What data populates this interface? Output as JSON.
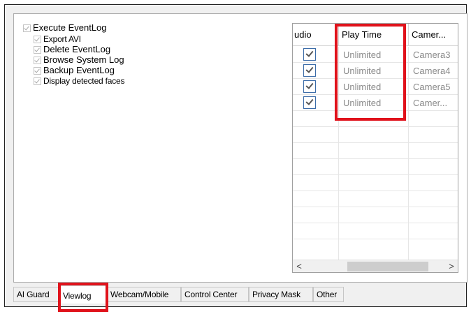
{
  "permissions": [
    {
      "label": "Execute EventLog",
      "checked": true
    },
    {
      "label": "Export AVI",
      "checked": true
    },
    {
      "label": "Delete EventLog",
      "checked": true
    },
    {
      "label": "Browse System Log",
      "checked": true
    },
    {
      "label": "Backup EventLog",
      "checked": true
    },
    {
      "label": "Display detected faces",
      "checked": true
    }
  ],
  "grid": {
    "columns": [
      "udio",
      "Play Time",
      "Camer..."
    ],
    "rows": [
      {
        "audio": true,
        "play_time": "Unlimited",
        "camera": "Camera3"
      },
      {
        "audio": true,
        "play_time": "Unlimited",
        "camera": "Camera4"
      },
      {
        "audio": true,
        "play_time": "Unlimited",
        "camera": "Camera5"
      },
      {
        "audio": true,
        "play_time": "Unlimited",
        "camera": "Camer..."
      }
    ],
    "scroll_left": "<",
    "scroll_right": ">"
  },
  "tabs": [
    "AI Guard",
    "Viewlog",
    "Webcam/Mobile",
    "Control Center",
    "Privacy Mask",
    "Other"
  ],
  "active_tab": "Viewlog",
  "colors": {
    "highlight": "#e0121b",
    "checkbox_border": "#3c6ca8"
  }
}
